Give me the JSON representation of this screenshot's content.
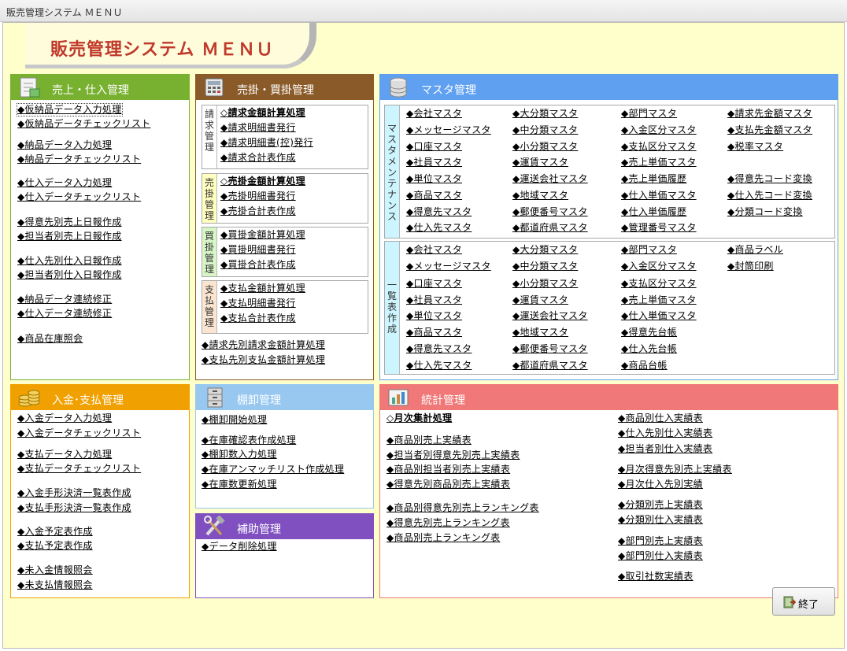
{
  "window": {
    "title": "販売管理システム ＭＥＮＵ"
  },
  "banner": {
    "title": "販売管理システム ＭＥＮＵ"
  },
  "colors": {
    "sales": "#78b030",
    "billing": "#8a5a28",
    "master": "#5fa0f0",
    "payment": "#f0a000",
    "inventory": "#98c8f0",
    "aux": "#8050c0",
    "stats": "#f07878"
  },
  "sales": {
    "title": "売上・仕入管理",
    "items": [
      "◆仮納品データ入力処理",
      "◆仮納品データチェックリスト",
      "◆納品データ入力処理",
      "◆納品データチェックリスト",
      "◆仕入データ入力処理",
      "◆仕入データチェックリスト",
      "◆得意先別売上日報作成",
      "◆担当者別売上日報作成",
      "◆仕入先別仕入日報作成",
      "◆担当者別仕入日報作成",
      "◆納品データ連続修正",
      "◆仕入データ連続修正",
      "◆商品在庫照会"
    ]
  },
  "billing": {
    "title": "売掛・買掛管理",
    "seikyu": {
      "label": "請求管理",
      "items": [
        "◇請求金額計算処理",
        "◆請求明細書発行",
        "◆請求明細書(控)発行",
        "◆請求合計表作成"
      ]
    },
    "urikake": {
      "label": "売掛管理",
      "items": [
        "◇売掛金額計算処理",
        "◆売掛明細書発行",
        "◆売掛合計表作成"
      ]
    },
    "kaikake": {
      "label": "買掛管理",
      "items": [
        "◆買掛金額計算処理",
        "◆買掛明細書発行",
        "◆買掛合計表作成"
      ]
    },
    "shiharai": {
      "label": "支払管理",
      "items": [
        "◆支払金額計算処理",
        "◆支払明細書発行",
        "◆支払合計表作成"
      ]
    },
    "extra": [
      "◆請求先別請求金額計算処理",
      "◆支払先別支払金額計算処理"
    ]
  },
  "master": {
    "title": "マスタ管理",
    "maint_label": "マスタメンテナンス",
    "maint": [
      [
        "◆会社マスタ",
        "◆メッセージマスタ",
        "◆口座マスタ",
        "◆社員マスタ",
        "◆単位マスタ",
        "◆商品マスタ",
        "◆得意先マスタ",
        "◆仕入先マスタ"
      ],
      [
        "◆大分類マスタ",
        "◆中分類マスタ",
        "◆小分類マスタ",
        "◆運賃マスタ",
        "◆運送会社マスタ",
        "◆地域マスタ",
        "◆郵便番号マスタ",
        "◆都道府県マスタ"
      ],
      [
        "◆部門マスタ",
        "◆入金区分マスタ",
        "◆支払区分マスタ",
        "◆売上単価マスタ",
        "◆売上単価履歴",
        "◆仕入単価マスタ",
        "◆仕入単価履歴",
        "◆管理番号マスタ"
      ],
      [
        "◆請求先金額マスタ",
        "◆支払先金額マスタ",
        "◆税率マスタ",
        "",
        "◆得意先コード変換",
        "◆仕入先コード変換",
        "◆分類コード変換"
      ]
    ],
    "list_label": "一覧表作成",
    "list": [
      [
        "◆会社マスタ",
        "◆メッセージマスタ",
        "◆口座マスタ",
        "◆社員マスタ",
        "◆単位マスタ",
        "◆商品マスタ",
        "◆得意先マスタ",
        "◆仕入先マスタ"
      ],
      [
        "◆大分類マスタ",
        "◆中分類マスタ",
        "◆小分類マスタ",
        "◆運賃マスタ",
        "◆運送会社マスタ",
        "◆地域マスタ",
        "◆郵便番号マスタ",
        "◆都道府県マスタ"
      ],
      [
        "◆部門マスタ",
        "◆入金区分マスタ",
        "◆支払区分マスタ",
        "◆売上単価マスタ",
        "◆仕入単価マスタ",
        "◆得意先台帳",
        "◆仕入先台帳",
        "◆商品台帳"
      ],
      [
        "◆商品ラベル",
        "◆封筒印刷"
      ]
    ]
  },
  "payment": {
    "title": "入金･支払管理",
    "items": [
      "◆入金データ入力処理",
      "◆入金データチェックリスト",
      "◆支払データ入力処理",
      "◆支払データチェックリスト",
      "◆入金手形決済一覧表作成",
      "◆支払手形決済一覧表作成",
      "◆入金予定表作成",
      "◆支払予定表作成",
      "◆未入金情報照会",
      "◆未支払情報照会"
    ]
  },
  "inventory": {
    "title": "棚卸管理",
    "items": [
      "◆棚卸開始処理",
      "◆在庫確認表作成処理",
      "◆棚卸数入力処理",
      "◆在庫アンマッチリスト作成処理",
      "◆在庫数更新処理"
    ]
  },
  "aux": {
    "title": "補助管理",
    "items": [
      "◆データ削除処理"
    ]
  },
  "stats": {
    "title": "統計管理",
    "left": [
      "◇月次集計処理",
      "◆商品別売上実績表",
      "◆担当者別得意先別売上実績表",
      "◆商品別担当者別売上実績表",
      "◆得意先別商品別売上実績表",
      "◆商品別得意先別売上ランキング表",
      "◆得意先別売上ランキング表",
      "◆商品別売上ランキング表"
    ],
    "right": [
      "◆商品別仕入実績表",
      "◆仕入先別仕入実績表",
      "◆担当者別仕入実績表",
      "◆月次得意先別売上実績表",
      "◆月次仕入先別実績",
      "◆分類別売上実績表",
      "◆分類別仕入実績表",
      "◆部門別売上実績表",
      "◆部門別仕入実績表",
      "◆取引社数実績表"
    ]
  },
  "footer": {
    "exit_label": "終了"
  }
}
